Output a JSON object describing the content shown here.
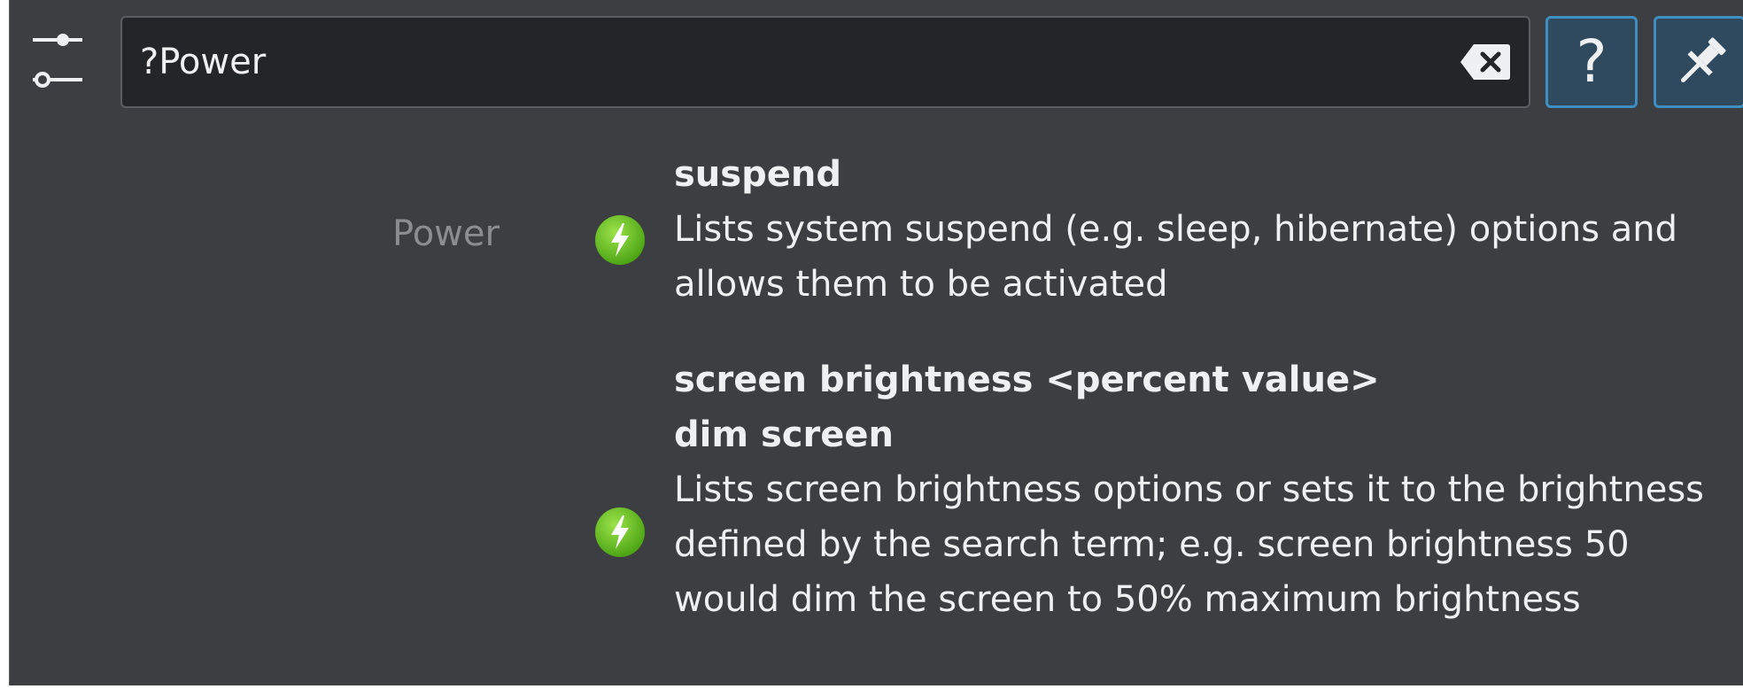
{
  "search": {
    "query": "?Power"
  },
  "toolbar": {
    "config_icon": "sliders-icon",
    "clear_icon": "clear-text-icon",
    "help_label": "?",
    "pin_icon": "pin-icon"
  },
  "results": {
    "category": "Power",
    "items": [
      {
        "icon": "power-bolt-icon",
        "titles": [
          "suspend"
        ],
        "description": "Lists system suspend (e.g. sleep, hibernate) options and allows them to be activated"
      },
      {
        "icon": "power-bolt-icon",
        "titles": [
          "screen brightness <percent value>",
          "dim screen"
        ],
        "description": "Lists screen brightness options or sets it to the brightness defined by the search term; e.g. screen brightness 50 would dim the screen to 50% maximum brightness"
      }
    ]
  },
  "colors": {
    "background": "#3c3e41",
    "search_field": "#232629",
    "accent": "#3f8ec2",
    "text": "#eff0f1",
    "muted_text": "#8b8e91",
    "icon_green": "#6cc21a"
  }
}
